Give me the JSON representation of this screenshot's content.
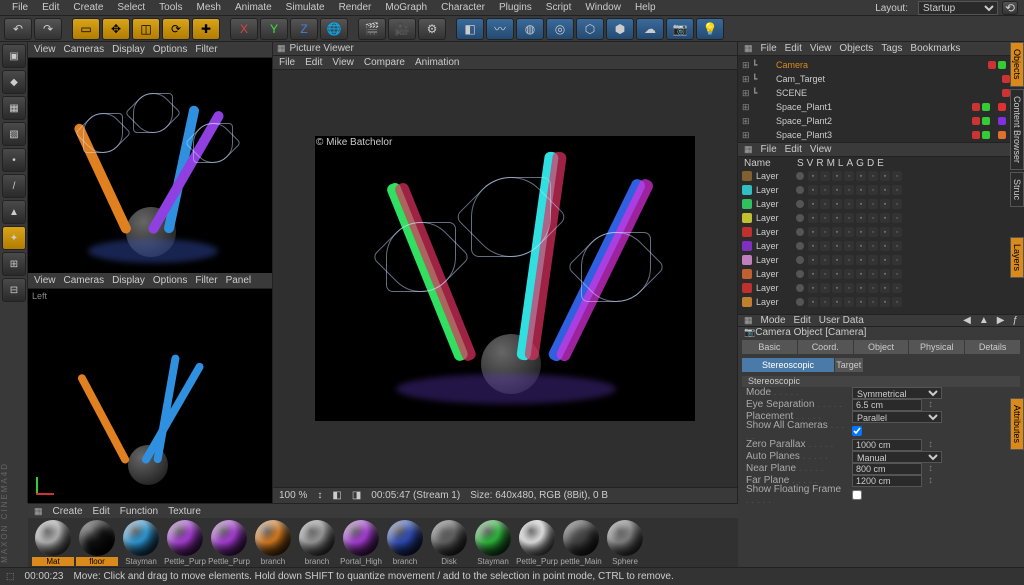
{
  "menu": [
    "File",
    "Edit",
    "Create",
    "Select",
    "Tools",
    "Mesh",
    "Animate",
    "Simulate",
    "Render",
    "MoGraph",
    "Character",
    "Plugins",
    "Script",
    "Window",
    "Help"
  ],
  "layout": {
    "label": "Layout:",
    "value": "Startup"
  },
  "vp_menu": [
    "View",
    "Cameras",
    "Display",
    "Options",
    "Filter"
  ],
  "vp_menu2": [
    "View",
    "Cameras",
    "Display",
    "Options",
    "Filter",
    "Panel"
  ],
  "vp2_title": "Left",
  "pv": {
    "title": "Picture Viewer",
    "menu": [
      "File",
      "Edit",
      "View",
      "Compare",
      "Animation"
    ],
    "attrib": "© Mike Batchelor",
    "zoom": "100 %",
    "time": "00:05:47 (Stream 1)",
    "size": "Size: 640x480, RGB (8Bit), 0 B"
  },
  "obj_menu": [
    "File",
    "Edit",
    "View",
    "Objects",
    "Tags",
    "Bookmarks"
  ],
  "objects": [
    {
      "name": "Camera",
      "sel": true,
      "d": [
        "#c33",
        "#3c3"
      ],
      "tag": "#d98a1a"
    },
    {
      "name": "Cam_Target",
      "d": [
        "#c33",
        "#3c3"
      ]
    },
    {
      "name": "SCENE",
      "d": [
        "#c33",
        "#3c3"
      ]
    },
    {
      "name": "Space_Plant1",
      "d": [
        "#c33",
        "#3c3"
      ],
      "sw": "#e03030",
      "tag": "#d98a1a"
    },
    {
      "name": "Space_Plant2",
      "d": [
        "#c33",
        "#3c3"
      ],
      "sw": "#8030e0",
      "tag": "#d98a1a"
    },
    {
      "name": "Space_Plant3",
      "d": [
        "#c33",
        "#3c3"
      ],
      "sw": "#e07030",
      "tag": "#d98a1a"
    }
  ],
  "layers_menu": [
    "File",
    "Edit",
    "View"
  ],
  "layer_cols": [
    "Name",
    "S",
    "V",
    "R",
    "M",
    "L",
    "A",
    "G",
    "D",
    "E"
  ],
  "layers": [
    {
      "c": "#806030",
      "n": "Layer"
    },
    {
      "c": "#30c0c0",
      "n": "Layer"
    },
    {
      "c": "#30c060",
      "n": "Layer"
    },
    {
      "c": "#c0c030",
      "n": "Layer"
    },
    {
      "c": "#c03030",
      "n": "Layer"
    },
    {
      "c": "#8030c0",
      "n": "Layer"
    },
    {
      "c": "#c080c0",
      "n": "Layer"
    },
    {
      "c": "#c06030",
      "n": "Layer"
    },
    {
      "c": "#c03030",
      "n": "Layer"
    },
    {
      "c": "#c08030",
      "n": "Layer",
      "sel": true
    }
  ],
  "attr_menu": [
    "Mode",
    "Edit",
    "User Data"
  ],
  "attr_title": "Camera Object [Camera]",
  "tabs1": [
    "Basic",
    "Coord.",
    "Object",
    "Physical",
    "Details"
  ],
  "tabs2": [
    "Stereoscopic",
    "Target"
  ],
  "section": "Stereoscopic",
  "props": {
    "mode_l": "Mode",
    "mode_v": "Symmetrical",
    "eye_l": "Eye Separation",
    "eye_v": "6.5 cm",
    "place_l": "Placement",
    "place_v": "Parallel",
    "showcam_l": "Show All Cameras",
    "zero_l": "Zero Parallax",
    "zero_v": "1000 cm",
    "autop_l": "Auto Planes",
    "autop_v": "Manual",
    "near_l": "Near Plane",
    "near_v": "800 cm",
    "far_l": "Far Plane",
    "far_v": "1200 cm",
    "float_l": "Show Floating Frame"
  },
  "mat_menu": [
    "Create",
    "Edit",
    "Function",
    "Texture"
  ],
  "materials": [
    {
      "n": "Mat",
      "c": "#bbb"
    },
    {
      "n": "floor",
      "c": "#111"
    },
    {
      "n": "Stayman",
      "c": "#30a0e0"
    },
    {
      "n": "Pettle_Purp",
      "c": "#b040e0"
    },
    {
      "n": "Pettle_Purp",
      "c": "#b040e0"
    },
    {
      "n": "branch",
      "c": "#e08020"
    },
    {
      "n": "branch",
      "c": "#a0a0a0"
    },
    {
      "n": "Portal_High",
      "c": "#b040e0"
    },
    {
      "n": "branch",
      "c": "#3050c0"
    },
    {
      "n": "Disk",
      "c": "#666"
    },
    {
      "n": "Stayman",
      "c": "#30c040"
    },
    {
      "n": "Pettle_Purp",
      "c": "#eee"
    },
    {
      "n": "pettle_Main",
      "c": "#444"
    },
    {
      "n": "Sphere",
      "c": "#888"
    }
  ],
  "status": {
    "time": "00:00:23",
    "hint": "Move: Click and drag to move elements. Hold down SHIFT to quantize movement / add to the selection in point mode, CTRL to remove."
  },
  "brand": "MAXON CINEMA4D",
  "rtabs": [
    "Objects",
    "Content Browser",
    "Struc",
    "Layers",
    "Attributes"
  ]
}
